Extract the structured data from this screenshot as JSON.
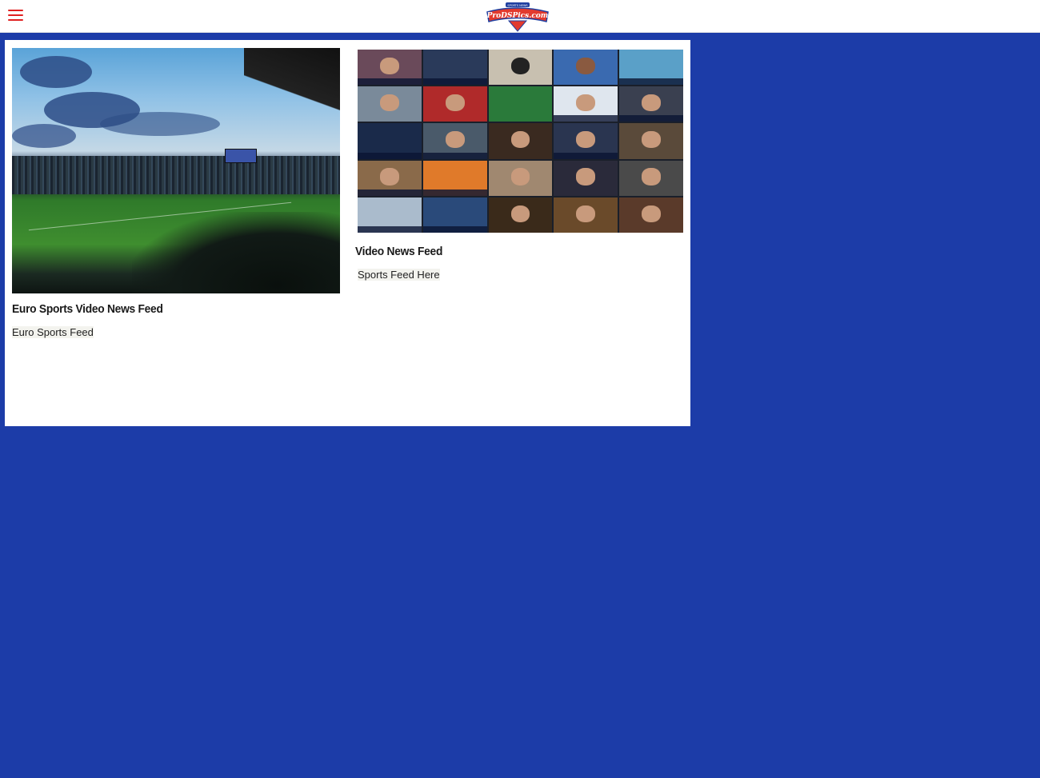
{
  "header": {
    "menu_icon": "hamburger-menu-icon",
    "logo_text": "ProDSPics.com",
    "logo_subtext": "SPORTS NEWS"
  },
  "cards": [
    {
      "title": "Euro Sports Video News Feed",
      "description": "Euro Sports Feed",
      "image": "soccer-stadium-image"
    },
    {
      "title": "Video News Feed",
      "description": "Sports Feed Here",
      "image": "video-collage-image"
    }
  ],
  "colors": {
    "background": "#1c3ca8",
    "accent": "#e02020",
    "panel": "#ffffff"
  }
}
